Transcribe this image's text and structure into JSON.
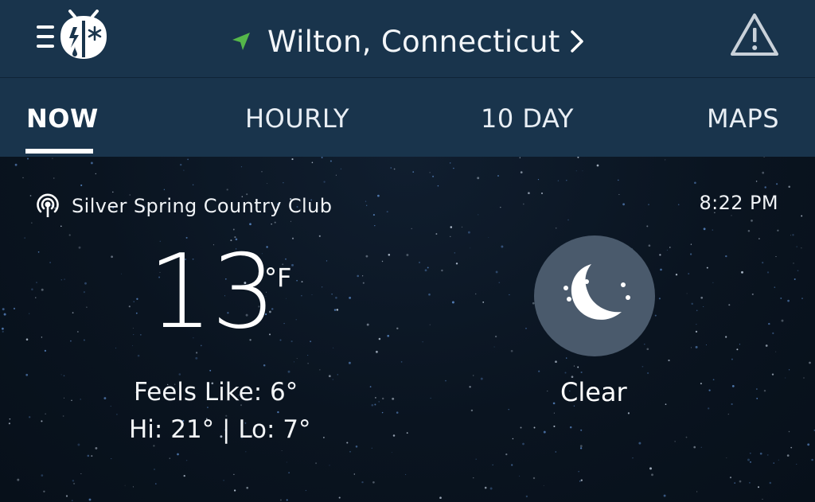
{
  "header": {
    "menu_icon": "menu-bug-logo-icon",
    "location_icon": "navigation-arrow-icon",
    "location": "Wilton,  Connecticut",
    "chevron_icon": "chevron-right-icon",
    "alert_icon": "warning-triangle-icon"
  },
  "tabs": [
    {
      "label": "NOW",
      "active": true
    },
    {
      "label": "HOURLY",
      "active": false
    },
    {
      "label": "10  DAY",
      "active": false
    },
    {
      "label": "MAPS",
      "active": false
    }
  ],
  "current": {
    "station_icon": "broadcast-station-icon",
    "station": "Silver Spring Country Club",
    "time": "8:22 PM",
    "temperature": "13",
    "unit": "°F",
    "feels_like": "Feels Like: 6°",
    "hi_lo": "Hi: 21° | Lo: 7°",
    "condition_icon": "moon-clear-night-icon",
    "condition": "Clear"
  },
  "colors": {
    "header_bg": "#19344c",
    "location_arrow": "#55b74a",
    "background": "#0a1420",
    "moon_circle": "#4a5a6c"
  }
}
